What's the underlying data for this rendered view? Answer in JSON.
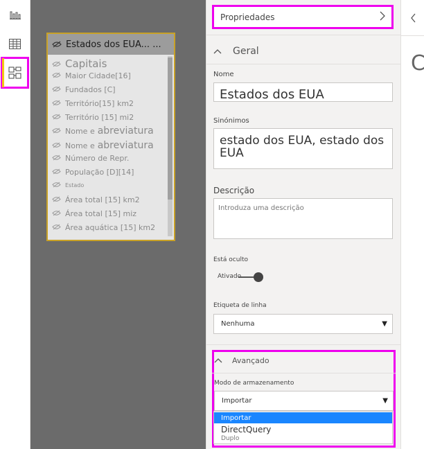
{
  "rail": {
    "items": [
      {
        "name": "report-view-icon"
      },
      {
        "name": "data-view-icon"
      },
      {
        "name": "model-view-icon"
      }
    ]
  },
  "canvas": {
    "table_name": "Estados dos EUA... ...",
    "fields": [
      "Capitais",
      "Maior Cidade[16]",
      "Fundados [C]",
      "Território[15] km2",
      "Território [15] mi2",
      "Nome e",
      "abreviatura",
      "Nome e",
      "abreviatura",
      "Número de Repr.",
      "População [D][14]",
      "Estado",
      "Área total [15] km2",
      "Área total [15] miz",
      "Área aquática [15] km2"
    ]
  },
  "properties": {
    "header": "Propriedades",
    "general": {
      "title": "Geral",
      "name_label": "Nome",
      "name_value": "Estados dos EUA",
      "synonyms_label": "Sinónimos",
      "synonyms_value": "estado dos EUA, estado dos EUA",
      "description_label": "Descrição",
      "description_placeholder": "Introduza uma descrição",
      "hidden_label": "Está oculto",
      "hidden_toggle_text": "Ativado",
      "row_label_label": "Etiqueta de linha",
      "row_label_value": "Nenhuma"
    },
    "advanced": {
      "title": "Avançado",
      "storage_mode_label": "Modo de armazenamento",
      "storage_mode_value": "Importar",
      "options": [
        "Importar",
        "DirectQuery",
        "Duplo"
      ]
    }
  },
  "right_pane": {
    "letter": "C"
  },
  "colors": {
    "highlight": "#ee00ee",
    "selected": "#1a86ff",
    "canvas": "#6b6b6b"
  }
}
